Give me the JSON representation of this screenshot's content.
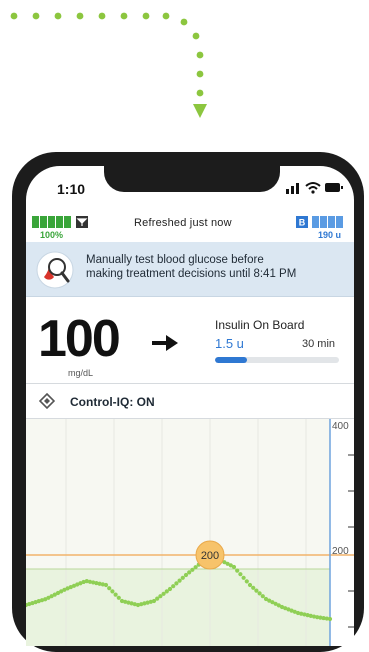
{
  "status_bar": {
    "time": "1:10"
  },
  "app_header": {
    "pump_battery": "100%",
    "refresh_status": "Refreshed just now",
    "insulin_reservoir_badge": "B",
    "insulin_remaining": "190 u"
  },
  "alert": {
    "line1": "Manually test blood glucose before",
    "line2": "making treatment decisions until 8:41 PM"
  },
  "glucose": {
    "value": "100",
    "unit": "mg/dL",
    "trend": "steady (right arrow)"
  },
  "insulin_on_board": {
    "label": "Insulin On Board",
    "value": "1.5 u",
    "time_remaining": "30 min",
    "fraction": 0.26
  },
  "control_iq": {
    "label": "Control-IQ: ON"
  },
  "graph": {
    "y_labels": [
      "400",
      "200"
    ],
    "high_threshold_marker": "200",
    "colors": {
      "high_line": "#f2b36b",
      "target_band": "#e9f3df",
      "cgm_dots": "#8fcf55",
      "now_line": "#6fa3dd",
      "marker": "#f7c36a"
    }
  }
}
